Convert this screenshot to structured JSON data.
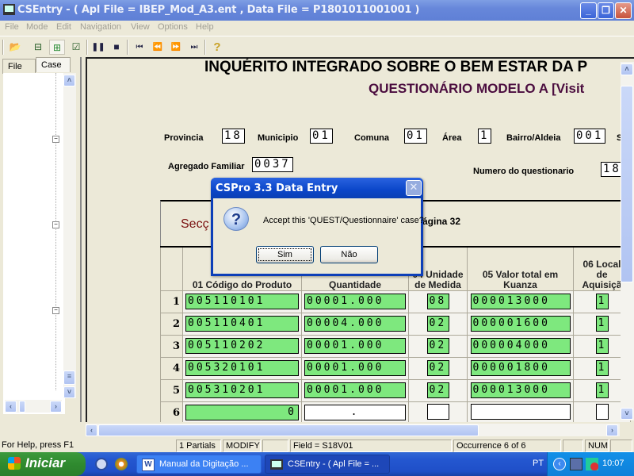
{
  "window": {
    "title": "CSEntry - ( Apl File = IBEP_Mod_A3.ent , Data File = P1801011001001 )",
    "minimize": "_",
    "restore": "❐",
    "close": "✕"
  },
  "menu": [
    "File",
    "Mode",
    "Edit",
    "Navigation",
    "View",
    "Options",
    "Help"
  ],
  "toolbar": {
    "icons": [
      "open-folder-icon",
      "add-case-icon",
      "insert-case-icon",
      "verify-icon",
      "pause-icon",
      "stop-icon",
      "first-icon",
      "previous-icon",
      "next-icon",
      "last-icon",
      "help-icon"
    ],
    "glyphs": [
      "📂",
      "⊟",
      "⊞",
      "☑",
      "❚❚",
      "■",
      "⏮",
      "⏪",
      "⏩",
      "⏭",
      "?"
    ]
  },
  "leftpanel": {
    "tabs": [
      "File",
      "Case"
    ]
  },
  "form": {
    "title": "INQUÉRITO INTEGRADO SOBRE O BEM ESTAR DA P",
    "subtitle": "QUESTIONÁRIO MODELO A   [Visit",
    "fields": {
      "provincia": {
        "label": "Provincia",
        "value": "18"
      },
      "municipio": {
        "label": "Municipio",
        "value": "01"
      },
      "comuna": {
        "label": "Comuna",
        "value": "01"
      },
      "area": {
        "label": "Área",
        "value": "1"
      },
      "bairro": {
        "label": "Bairro/Aldeia",
        "value": "001"
      },
      "bairro_cut": "S",
      "agregado": {
        "label": "Agregado Familiar",
        "value": "0037"
      },
      "numero": {
        "label": "Numero do questionario",
        "value": "18"
      }
    },
    "section": {
      "label": "Secç",
      "page": "ágina 32"
    },
    "columns": [
      "",
      "01 Código do Produto",
      "Quantidade",
      "04 Unidade de Medida",
      "05 Valor total em Kuanza",
      "06 Local de Aquisiçã"
    ],
    "rows": [
      {
        "n": "1",
        "codigo": "005110101",
        "quantidade": "00001.000",
        "unidade": "08",
        "valor": "000013000",
        "local": "1"
      },
      {
        "n": "2",
        "codigo": "005110401",
        "quantidade": "00004.000",
        "unidade": "02",
        "valor": "000001600",
        "local": "1"
      },
      {
        "n": "3",
        "codigo": "005110202",
        "quantidade": "00001.000",
        "unidade": "02",
        "valor": "000004000",
        "local": "1"
      },
      {
        "n": "4",
        "codigo": "005320101",
        "quantidade": "00001.000",
        "unidade": "02",
        "valor": "000001800",
        "local": "1"
      },
      {
        "n": "5",
        "codigo": "005310201",
        "quantidade": "00001.000",
        "unidade": "02",
        "valor": "000013000",
        "local": "1"
      },
      {
        "n": "6",
        "codigo": "0",
        "quantidade": ".",
        "unidade": "",
        "valor": "",
        "local": ""
      }
    ]
  },
  "dialog": {
    "title": "CSPro 3.3 Data Entry",
    "close": "✕",
    "icon": "?",
    "message": "Accept this 'QUEST/Questionnaire' case?",
    "yes": "Sim",
    "no": "Não"
  },
  "statusbar": {
    "help": "For Help, press F1",
    "partials": "1 Partials",
    "mode": "MODIFY",
    "field": "Field = S18V01",
    "occurrence": "Occurrence 6 of 6",
    "num": "NUM"
  },
  "taskbar": {
    "start": "Iniciar",
    "tasks": [
      "Manual da Digitação ...",
      "CSEntry - ( Apl File = ..."
    ],
    "language": "PT",
    "clock": "10:07"
  }
}
